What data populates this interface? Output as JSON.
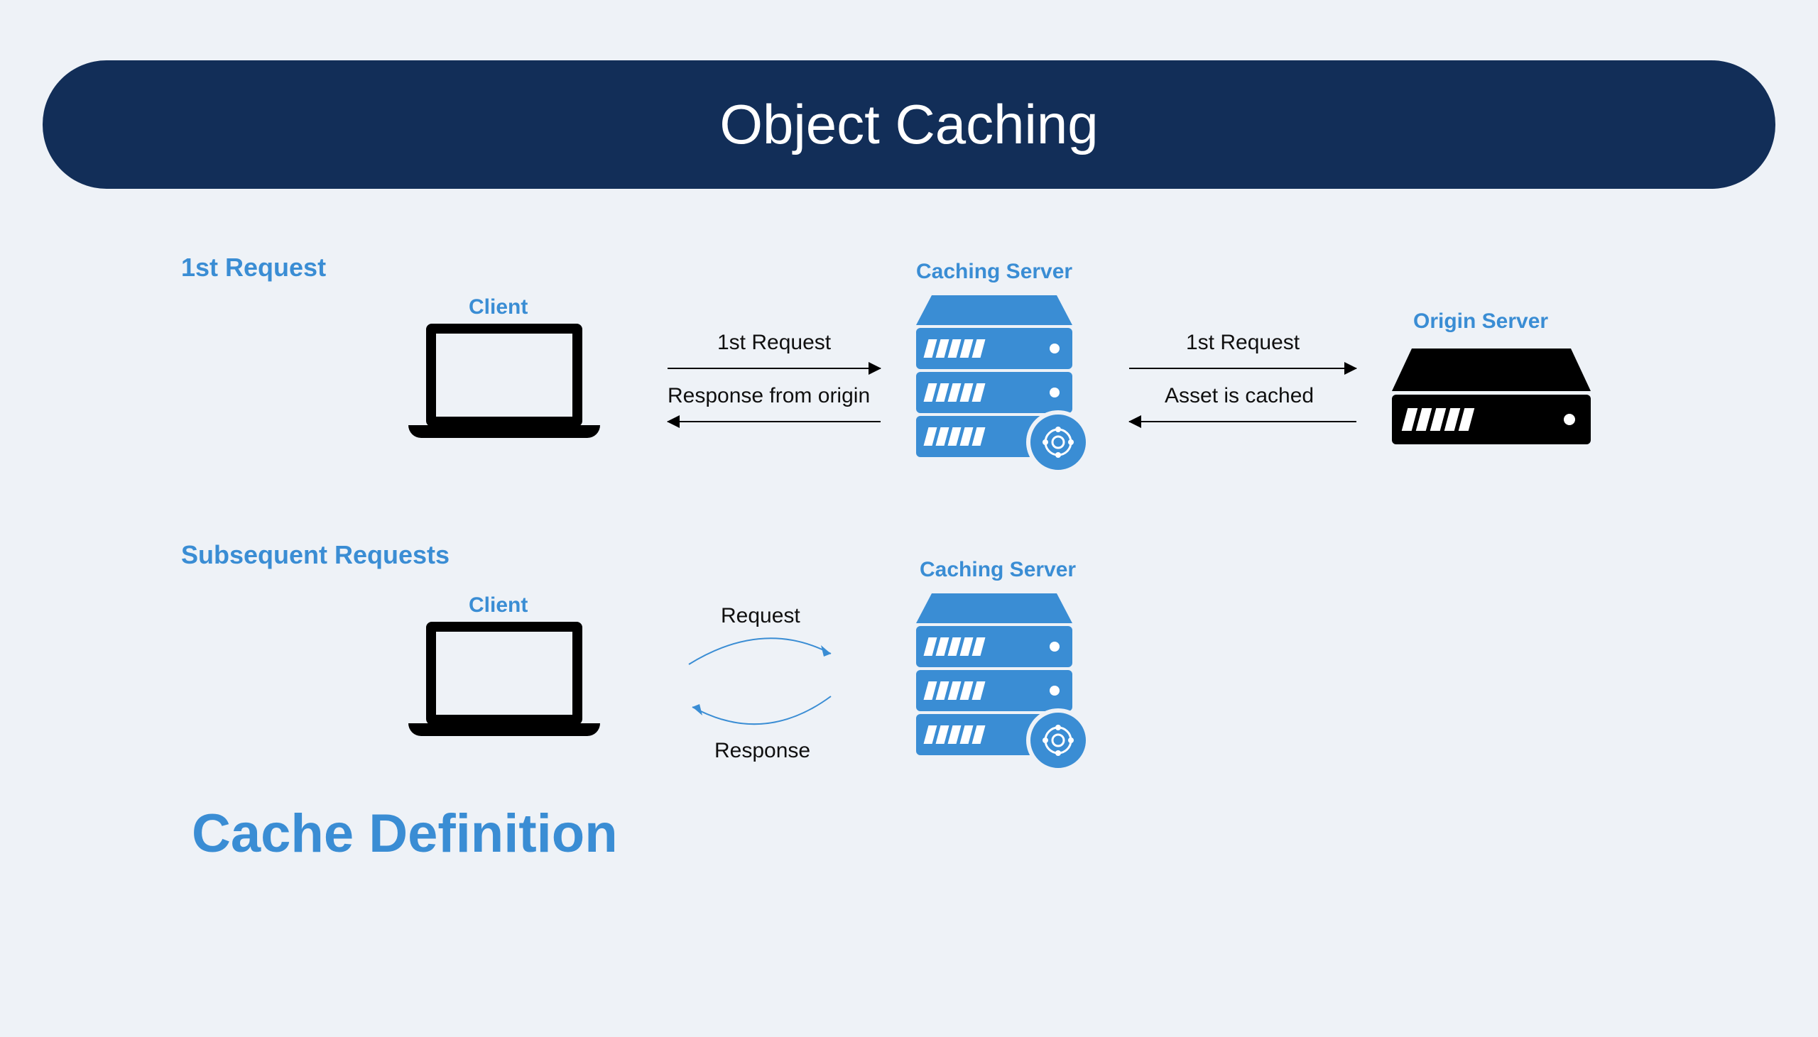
{
  "title": "Object Caching",
  "section1": {
    "heading": "1st Request",
    "client_label": "Client",
    "cache_label": "Caching Server",
    "origin_label": "Origin Server",
    "arrow_req1": "1st Request",
    "arrow_resp1": "Response from origin",
    "arrow_req2": "1st Request",
    "arrow_resp2": "Asset is cached"
  },
  "section2": {
    "heading": "Subsequent Requests",
    "client_label": "Client",
    "cache_label": "Caching Server",
    "arrow_req": "Request",
    "arrow_resp": "Response"
  },
  "bottom_title": "Cache Definition"
}
